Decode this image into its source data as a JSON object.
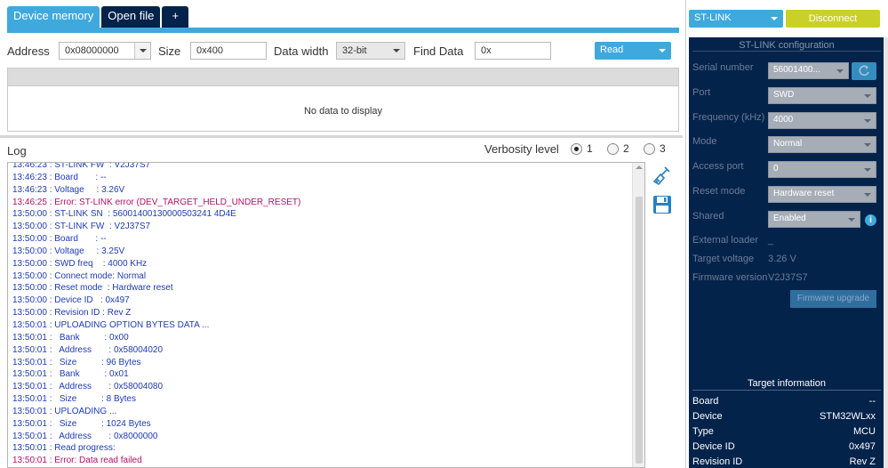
{
  "tabs": [
    {
      "label": "Device memory",
      "active": true
    },
    {
      "label": "Open file",
      "active": false
    },
    {
      "label": "+",
      "active": false
    }
  ],
  "memory": {
    "address_label": "Address",
    "address_value": "0x08000000",
    "size_label": "Size",
    "size_value": "0x400",
    "data_width_label": "Data width",
    "data_width_value": "32-bit",
    "find_label": "Find Data",
    "find_value": "0x",
    "read_button": "Read",
    "empty_message": "No data to display"
  },
  "log": {
    "title": "Log",
    "verbosity_label": "Verbosity level",
    "verbosity_options": [
      "1",
      "2",
      "3"
    ],
    "verbosity_selected": "1",
    "lines": [
      {
        "text": "13:46:23 : ST-LINK FW  : V2J37S7",
        "level": "info"
      },
      {
        "text": "13:46:23 : Board       : --",
        "level": "info"
      },
      {
        "text": "13:46:23 : Voltage     : 3.26V",
        "level": "info"
      },
      {
        "text": "13:46:25 : Error: ST-LINK error (DEV_TARGET_HELD_UNDER_RESET)",
        "level": "err"
      },
      {
        "text": "13:50:00 : ST-LINK SN  : 56001400130000503241 4D4E",
        "level": "info"
      },
      {
        "text": "13:50:00 : ST-LINK FW  : V2J37S7",
        "level": "info"
      },
      {
        "text": "13:50:00 : Board       : --",
        "level": "info"
      },
      {
        "text": "13:50:00 : Voltage     : 3.25V",
        "level": "info"
      },
      {
        "text": "13:50:00 : SWD freq    : 4000 KHz",
        "level": "info"
      },
      {
        "text": "13:50:00 : Connect mode: Normal",
        "level": "info"
      },
      {
        "text": "13:50:00 : Reset mode  : Hardware reset",
        "level": "info"
      },
      {
        "text": "13:50:00 : Device ID   : 0x497",
        "level": "info"
      },
      {
        "text": "13:50:00 : Revision ID : Rev Z",
        "level": "info"
      },
      {
        "text": "13:50:01 : UPLOADING OPTION BYTES DATA ...",
        "level": "info"
      },
      {
        "text": "13:50:01 :   Bank          : 0x00",
        "level": "info"
      },
      {
        "text": "13:50:01 :   Address       : 0x58004020",
        "level": "info"
      },
      {
        "text": "13:50:01 :   Size          : 96 Bytes",
        "level": "info"
      },
      {
        "text": "13:50:01 :   Bank          : 0x01",
        "level": "info"
      },
      {
        "text": "13:50:01 :   Address       : 0x58004080",
        "level": "info"
      },
      {
        "text": "13:50:01 :   Size          : 8 Bytes",
        "level": "info"
      },
      {
        "text": "13:50:01 : UPLOADING ...",
        "level": "info"
      },
      {
        "text": "13:50:01 :   Size          : 1024 Bytes",
        "level": "info"
      },
      {
        "text": "13:50:01 :   Address       : 0x8000000",
        "level": "info"
      },
      {
        "text": "13:50:01 : Read progress:",
        "level": "info"
      },
      {
        "text": "13:50:01 : Error: Data read failed",
        "level": "err"
      }
    ]
  },
  "connection": {
    "probe": "ST-LINK",
    "disconnect_label": "Disconnect"
  },
  "config": {
    "title": "ST-LINK configuration",
    "serial_label": "Serial number",
    "serial_value": "56001400...",
    "port_label": "Port",
    "port_value": "SWD",
    "freq_label": "Frequency (kHz)",
    "freq_value": "4000",
    "mode_label": "Mode",
    "mode_value": "Normal",
    "access_port_label": "Access port",
    "access_port_value": "0",
    "reset_label": "Reset mode",
    "reset_value": "Hardware reset",
    "shared_label": "Shared",
    "shared_value": "Enabled",
    "ext_loader_label": "External loader",
    "ext_loader_value": "_",
    "target_voltage_label": "Target voltage",
    "target_voltage_value": "3.26 V",
    "fw_version_label": "Firmware version",
    "fw_version_value": "V2J37S7",
    "fw_upgrade_label": "Firmware upgrade"
  },
  "target": {
    "title": "Target information",
    "rows": [
      {
        "key": "Board",
        "value": "--"
      },
      {
        "key": "Device",
        "value": "STM32WLxx"
      },
      {
        "key": "Type",
        "value": "MCU"
      },
      {
        "key": "Device ID",
        "value": "0x497"
      },
      {
        "key": "Revision ID",
        "value": "Rev Z"
      }
    ]
  },
  "colors": {
    "accent": "#3fa9dd",
    "navy": "#03234b",
    "disconnect": "#c9d128",
    "log_info": "#1f3bb3",
    "log_error": "#b0106a"
  }
}
